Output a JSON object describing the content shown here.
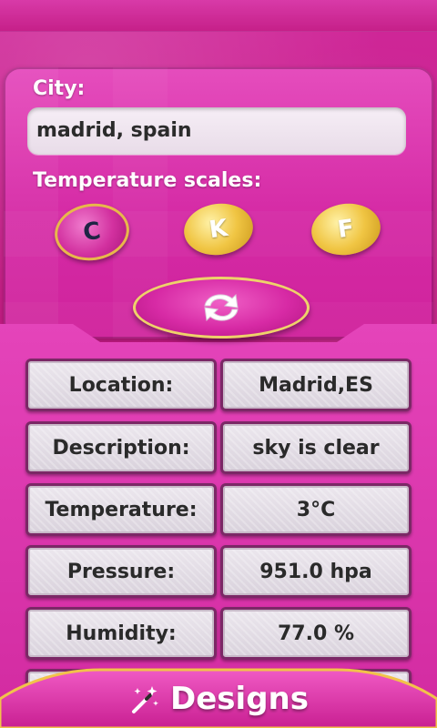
{
  "city": {
    "label": "City:",
    "value": "madrid, spain"
  },
  "scales": {
    "label": "Temperature scales:",
    "options": [
      "C",
      "K",
      "F"
    ],
    "selected": "C"
  },
  "results": [
    {
      "label": "Location:",
      "value": "Madrid,ES"
    },
    {
      "label": "Description:",
      "value": "sky is clear"
    },
    {
      "label": "Temperature:",
      "value": "3°C"
    },
    {
      "label": "Pressure:",
      "value": "951.0 hpa"
    },
    {
      "label": "Humidity:",
      "value": "77.0 %"
    }
  ],
  "bottom": {
    "label": "Designs",
    "icon": "magic-wand-icon"
  },
  "colors": {
    "primary_pink": "#d22aa0",
    "gold": "#f0c543",
    "cell_border": "#7b2866"
  }
}
